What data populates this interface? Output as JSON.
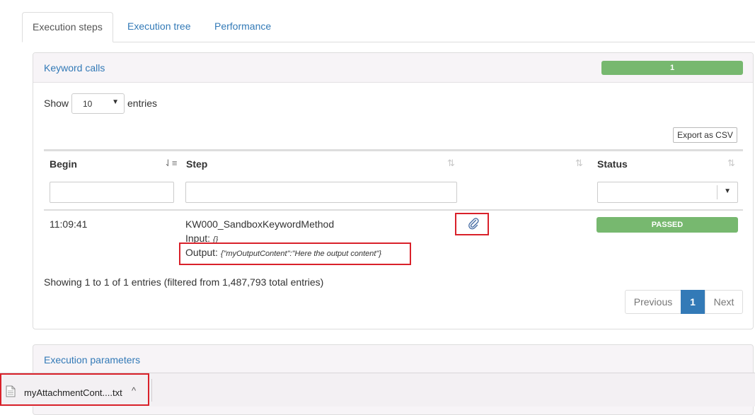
{
  "tabs": [
    {
      "label": "Execution steps"
    },
    {
      "label": "Execution tree"
    },
    {
      "label": "Performance"
    }
  ],
  "keyword_panel": {
    "title": "Keyword calls",
    "count": "1",
    "show_label": "Show",
    "page_size": "10",
    "entries_label": "entries",
    "export_label": "Export as CSV",
    "columns": [
      "Begin",
      "Step",
      "Status"
    ],
    "rows": [
      {
        "begin": "11:09:41",
        "step": "KW000_SandboxKeywordMethod",
        "input_label": "Input:",
        "input_value": "{}",
        "output_label": "Output:",
        "output_value": "{\"myOutputContent\":\"Here the output content\"}",
        "status": "PASSED"
      }
    ],
    "info": "Showing 1 to 1 of 1 entries (filtered from 1,487,793 total entries)",
    "pagination": {
      "previous": "Previous",
      "current": "1",
      "next": "Next"
    }
  },
  "params_panel": {
    "title": "Execution parameters"
  },
  "download_bar": {
    "filename": "myAttachmentCont....txt",
    "chevron": "^"
  },
  "colors": {
    "accent": "#337ab7",
    "success": "#77b86f",
    "highlight": "#d9212a"
  }
}
